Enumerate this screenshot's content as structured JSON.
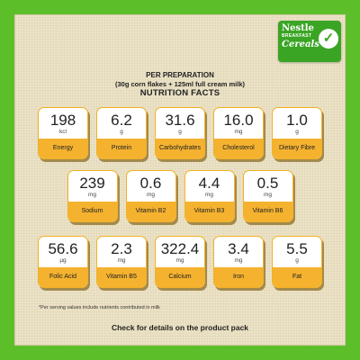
{
  "brand": {
    "name": "Nestle",
    "line": "BREAKFAST",
    "script": "Cereals"
  },
  "header": {
    "line1": "PER PREPARATION",
    "line2": "(30g corn flakes + 125ml full cream milk)",
    "title": "NUTRITION FACTS"
  },
  "rows": [
    [
      {
        "value": "198",
        "unit": "kcl",
        "label": "Energy"
      },
      {
        "value": "6.2",
        "unit": "g",
        "label": "Protein"
      },
      {
        "value": "31.6",
        "unit": "g",
        "label": "Carbohydrates"
      },
      {
        "value": "16.0",
        "unit": "mg",
        "label": "Cholesterol"
      },
      {
        "value": "1.0",
        "unit": "g",
        "label": "Dietary Fibre"
      }
    ],
    [
      {
        "value": "239",
        "unit": "mg",
        "label": "Sodium"
      },
      {
        "value": "0.6",
        "unit": "mg",
        "label": "Vitamin B2"
      },
      {
        "value": "4.4",
        "unit": "mg",
        "label": "Vitamin B3"
      },
      {
        "value": "0.5",
        "unit": "mg",
        "label": "Vitamin B6"
      }
    ],
    [
      {
        "value": "56.6",
        "unit": "µg",
        "label": "Folic Acid"
      },
      {
        "value": "2.3",
        "unit": "mg",
        "label": "Vitamin B5"
      },
      {
        "value": "322.4",
        "unit": "mg",
        "label": "Calcium"
      },
      {
        "value": "3.4",
        "unit": "mg",
        "label": "Iron"
      },
      {
        "value": "5.5",
        "unit": "g",
        "label": "Fat"
      }
    ]
  ],
  "footnote": "*Per serving values include nutrients contributed in milk",
  "cta": "Check for details on the product pack",
  "colors": {
    "background": "#5cbf2a",
    "board": "#ece3c6",
    "accent": "#f4b22f",
    "logo": "#3aa524"
  },
  "icons": {
    "logo_mark": "check-icon"
  }
}
